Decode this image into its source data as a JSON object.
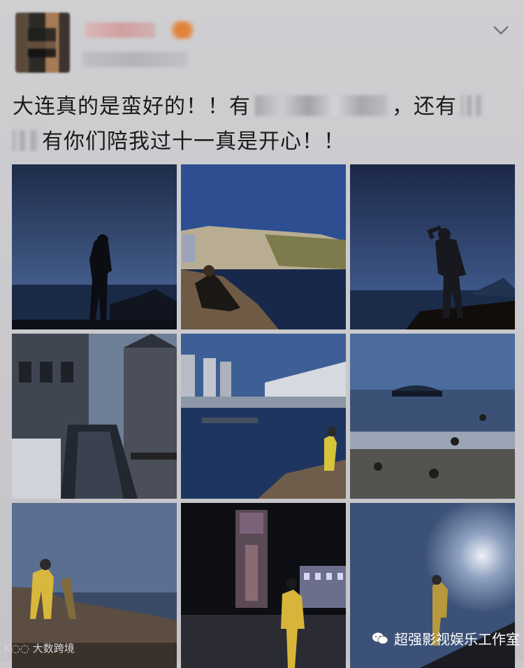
{
  "post": {
    "text_line1_a": "大连真的是蛮好的！！有",
    "text_line1_b": "，还有",
    "text_line2": "有你们陪我过十一真是开心！！"
  },
  "photos": [
    {
      "id": "1",
      "subject": "silhouette-man-sea"
    },
    {
      "id": "2",
      "subject": "woman-sitting-cliff"
    },
    {
      "id": "3",
      "subject": "man-shading-eyes"
    },
    {
      "id": "4",
      "subject": "canal-town"
    },
    {
      "id": "5",
      "subject": "harbor-buildings"
    },
    {
      "id": "6",
      "subject": "sea-island-rocks"
    },
    {
      "id": "7",
      "subject": "people-rocks"
    },
    {
      "id": "8",
      "subject": "clock-tower-night"
    },
    {
      "id": "9",
      "subject": "silhouette-sun"
    }
  ],
  "watermarks": {
    "left": "大数跨境",
    "right": "超强影视娱乐工作室"
  },
  "icons": {
    "expand": "chevron-down-icon",
    "wechat": "wechat-icon",
    "logo": "logo-icon"
  },
  "colors": {
    "background": "#c9c9cc",
    "text": "#1a1a1a"
  }
}
